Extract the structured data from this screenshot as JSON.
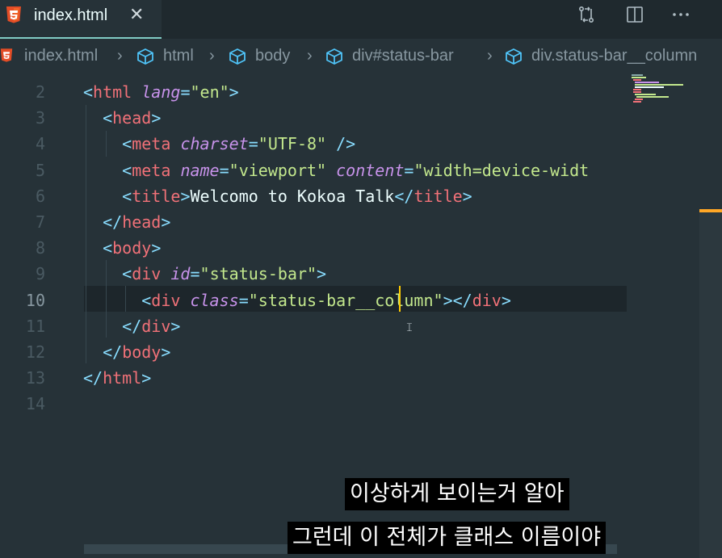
{
  "tab": {
    "file_label": "index.html",
    "close_glyph": "✕",
    "icon": "html5-icon"
  },
  "actions": [
    {
      "name": "compare-changes-icon",
      "glyph": "⇅"
    },
    {
      "name": "split-editor-icon",
      "glyph": "◫"
    },
    {
      "name": "more-actions-icon",
      "glyph": "⋯"
    }
  ],
  "breadcrumb": [
    {
      "label": "index.html",
      "icon": "html5-icon"
    },
    {
      "label": "html",
      "icon": "cube-icon"
    },
    {
      "label": "body",
      "icon": "cube-icon"
    },
    {
      "label": "div#status-bar",
      "icon": "cube-icon"
    },
    {
      "label": "div.status-bar__column",
      "icon": "cube-icon"
    }
  ],
  "breadcrumb_separator": "›",
  "editor": {
    "line_numbers": [
      "2",
      "3",
      "4",
      "5",
      "6",
      "7",
      "8",
      "9",
      "10",
      "11",
      "12",
      "13",
      "14"
    ],
    "active_line": "10",
    "lines": [
      [
        [
          "br",
          "<"
        ],
        [
          "tag",
          "html"
        ],
        [
          "txt",
          " "
        ],
        [
          "attr",
          "lang"
        ],
        [
          "eq",
          "="
        ],
        [
          "str",
          "\"en\""
        ],
        [
          "br",
          ">"
        ]
      ],
      [
        [
          "txt",
          "  "
        ],
        [
          "br",
          "<"
        ],
        [
          "tag",
          "head"
        ],
        [
          "br",
          ">"
        ]
      ],
      [
        [
          "txt",
          "    "
        ],
        [
          "br",
          "<"
        ],
        [
          "tag",
          "meta"
        ],
        [
          "txt",
          " "
        ],
        [
          "attr",
          "charset"
        ],
        [
          "eq",
          "="
        ],
        [
          "str",
          "\"UTF-8\""
        ],
        [
          "txt",
          " "
        ],
        [
          "br",
          "/>"
        ]
      ],
      [
        [
          "txt",
          "    "
        ],
        [
          "br",
          "<"
        ],
        [
          "tag",
          "meta"
        ],
        [
          "txt",
          " "
        ],
        [
          "attr",
          "name"
        ],
        [
          "eq",
          "="
        ],
        [
          "str",
          "\"viewport\""
        ],
        [
          "txt",
          " "
        ],
        [
          "attr",
          "content"
        ],
        [
          "eq",
          "="
        ],
        [
          "str",
          "\"width=device-widt"
        ]
      ],
      [
        [
          "txt",
          "    "
        ],
        [
          "br",
          "<"
        ],
        [
          "tag",
          "title"
        ],
        [
          "br",
          ">"
        ],
        [
          "txt",
          "Welcomo to Kokoa Talk"
        ],
        [
          "br",
          "</"
        ],
        [
          "tag",
          "title"
        ],
        [
          "br",
          ">"
        ]
      ],
      [
        [
          "txt",
          "  "
        ],
        [
          "br",
          "</"
        ],
        [
          "tag",
          "head"
        ],
        [
          "br",
          ">"
        ]
      ],
      [
        [
          "txt",
          "  "
        ],
        [
          "br",
          "<"
        ],
        [
          "tag",
          "body"
        ],
        [
          "br",
          ">"
        ]
      ],
      [
        [
          "txt",
          "    "
        ],
        [
          "br",
          "<"
        ],
        [
          "tag",
          "div"
        ],
        [
          "txt",
          " "
        ],
        [
          "attr",
          "id"
        ],
        [
          "eq",
          "="
        ],
        [
          "str",
          "\"status-bar\""
        ],
        [
          "br",
          ">"
        ]
      ],
      [
        [
          "txt",
          "      "
        ],
        [
          "br",
          "<"
        ],
        [
          "tag",
          "div"
        ],
        [
          "txt",
          " "
        ],
        [
          "attr",
          "class"
        ],
        [
          "eq",
          "="
        ],
        [
          "str",
          "\"status-bar__column\""
        ],
        [
          "br",
          "></"
        ],
        [
          "tag",
          "div"
        ],
        [
          "br",
          ">"
        ]
      ],
      [
        [
          "txt",
          "    "
        ],
        [
          "br",
          "</"
        ],
        [
          "tag",
          "div"
        ],
        [
          "br",
          ">"
        ]
      ],
      [
        [
          "txt",
          "  "
        ],
        [
          "br",
          "</"
        ],
        [
          "tag",
          "body"
        ],
        [
          "br",
          ">"
        ]
      ],
      [
        [
          "br",
          "</"
        ],
        [
          "tag",
          "html"
        ],
        [
          "br",
          ">"
        ]
      ],
      []
    ]
  },
  "subtitles": {
    "line1": "이상하게 보이는거 알아",
    "line2": "그런데 이 전체가 클래스 이름이야"
  },
  "colors": {
    "background": "#263238",
    "tag": "#f07178",
    "bracket": "#89ddff",
    "attribute": "#c792ea",
    "string": "#c3e88d",
    "cursor": "#ffcc00",
    "scroll_marker": "#ffa726"
  }
}
